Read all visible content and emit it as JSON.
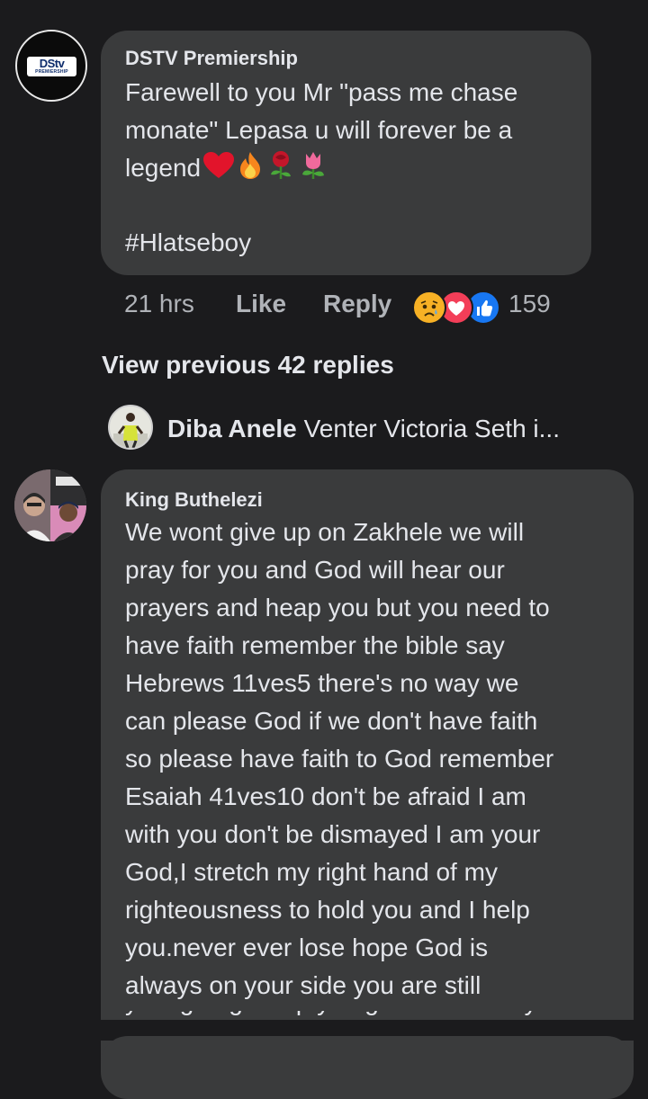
{
  "comment1": {
    "author": "DSTV Premiership",
    "avatar_logo": "DStv",
    "avatar_logo_sub": "PREMIERSHIP",
    "lines": [
      "Farewell to you Mr \"pass me chase",
      "monate\" Lepasa u will forever be a",
      "legend"
    ],
    "emojis": [
      "heart-icon",
      "fire-icon",
      "rose-icon",
      "tulip-icon"
    ],
    "hashtag": "#Hlatseboy",
    "time": "21 hrs",
    "like_label": "Like",
    "reply_label": "Reply",
    "reactions": [
      "sad-reaction-icon",
      "love-reaction-icon",
      "like-reaction-icon"
    ],
    "reaction_count": "159"
  },
  "view_previous": "View previous 42 replies",
  "collapsed_reply": {
    "name": "Diba Anele",
    "preview": "Venter Victoria Seth i..."
  },
  "comment2": {
    "author": "King Buthelezi",
    "lines": [
      "We wont give up on Zakhele we will",
      "pray for you and God will hear our",
      "prayers and heap you but you need to",
      "have faith remember the bible say",
      "Hebrews 11ves5 there's no way we",
      "can please God if we don't have faith",
      "so please have faith to God remember",
      "Esaiah 41ves10 don't be afraid I am",
      "with you don't be dismayed I am your",
      "God,I stretch my right hand of my",
      "righteousness to hold you and I help",
      "you.never ever lose hope God is",
      "always on your side you are still",
      "young to give up you get healed very"
    ]
  },
  "colors": {
    "background": "#1b1b1d",
    "bubble": "#3a3b3c",
    "primary_text": "#e4e6eb",
    "secondary_text": "#b0b3b8",
    "like_blue": "#1877f2",
    "love_red": "#f33e58",
    "sad_yellow": "#f7b125"
  }
}
